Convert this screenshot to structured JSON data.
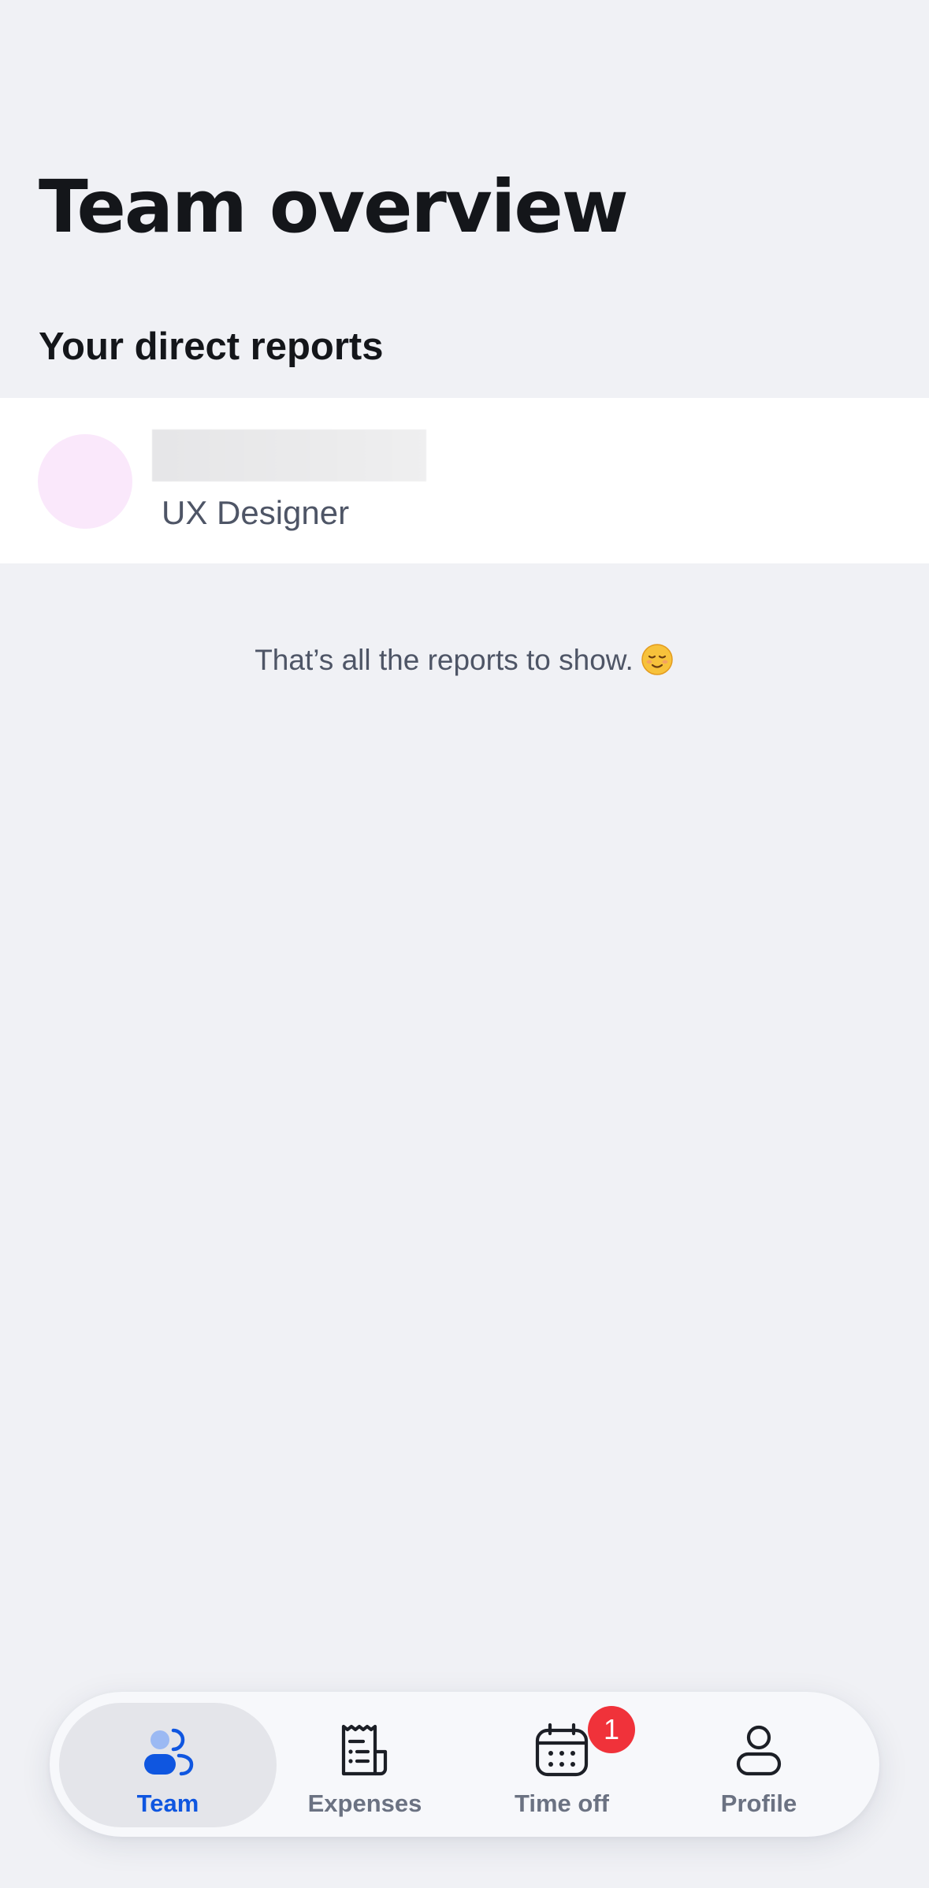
{
  "header": {
    "title": "Team overview"
  },
  "reports_section": {
    "heading": "Your direct reports",
    "items": [
      {
        "role": "UX Designer",
        "avatar_color": "#fae8fb"
      }
    ],
    "end_message": "That’s all the reports to show."
  },
  "bottom_nav": {
    "active_color": "#0f56e0",
    "inactive_color": "#6b7282",
    "items": [
      {
        "label": "Team",
        "icon": "team-icon",
        "active": true
      },
      {
        "label": "Expenses",
        "icon": "receipt-icon",
        "active": false
      },
      {
        "label": "Time off",
        "icon": "calendar-icon",
        "active": false,
        "badge": "1"
      },
      {
        "label": "Profile",
        "icon": "person-icon",
        "active": false
      }
    ]
  },
  "colors": {
    "background": "#f0f1f5",
    "badge": "#f0323a"
  }
}
